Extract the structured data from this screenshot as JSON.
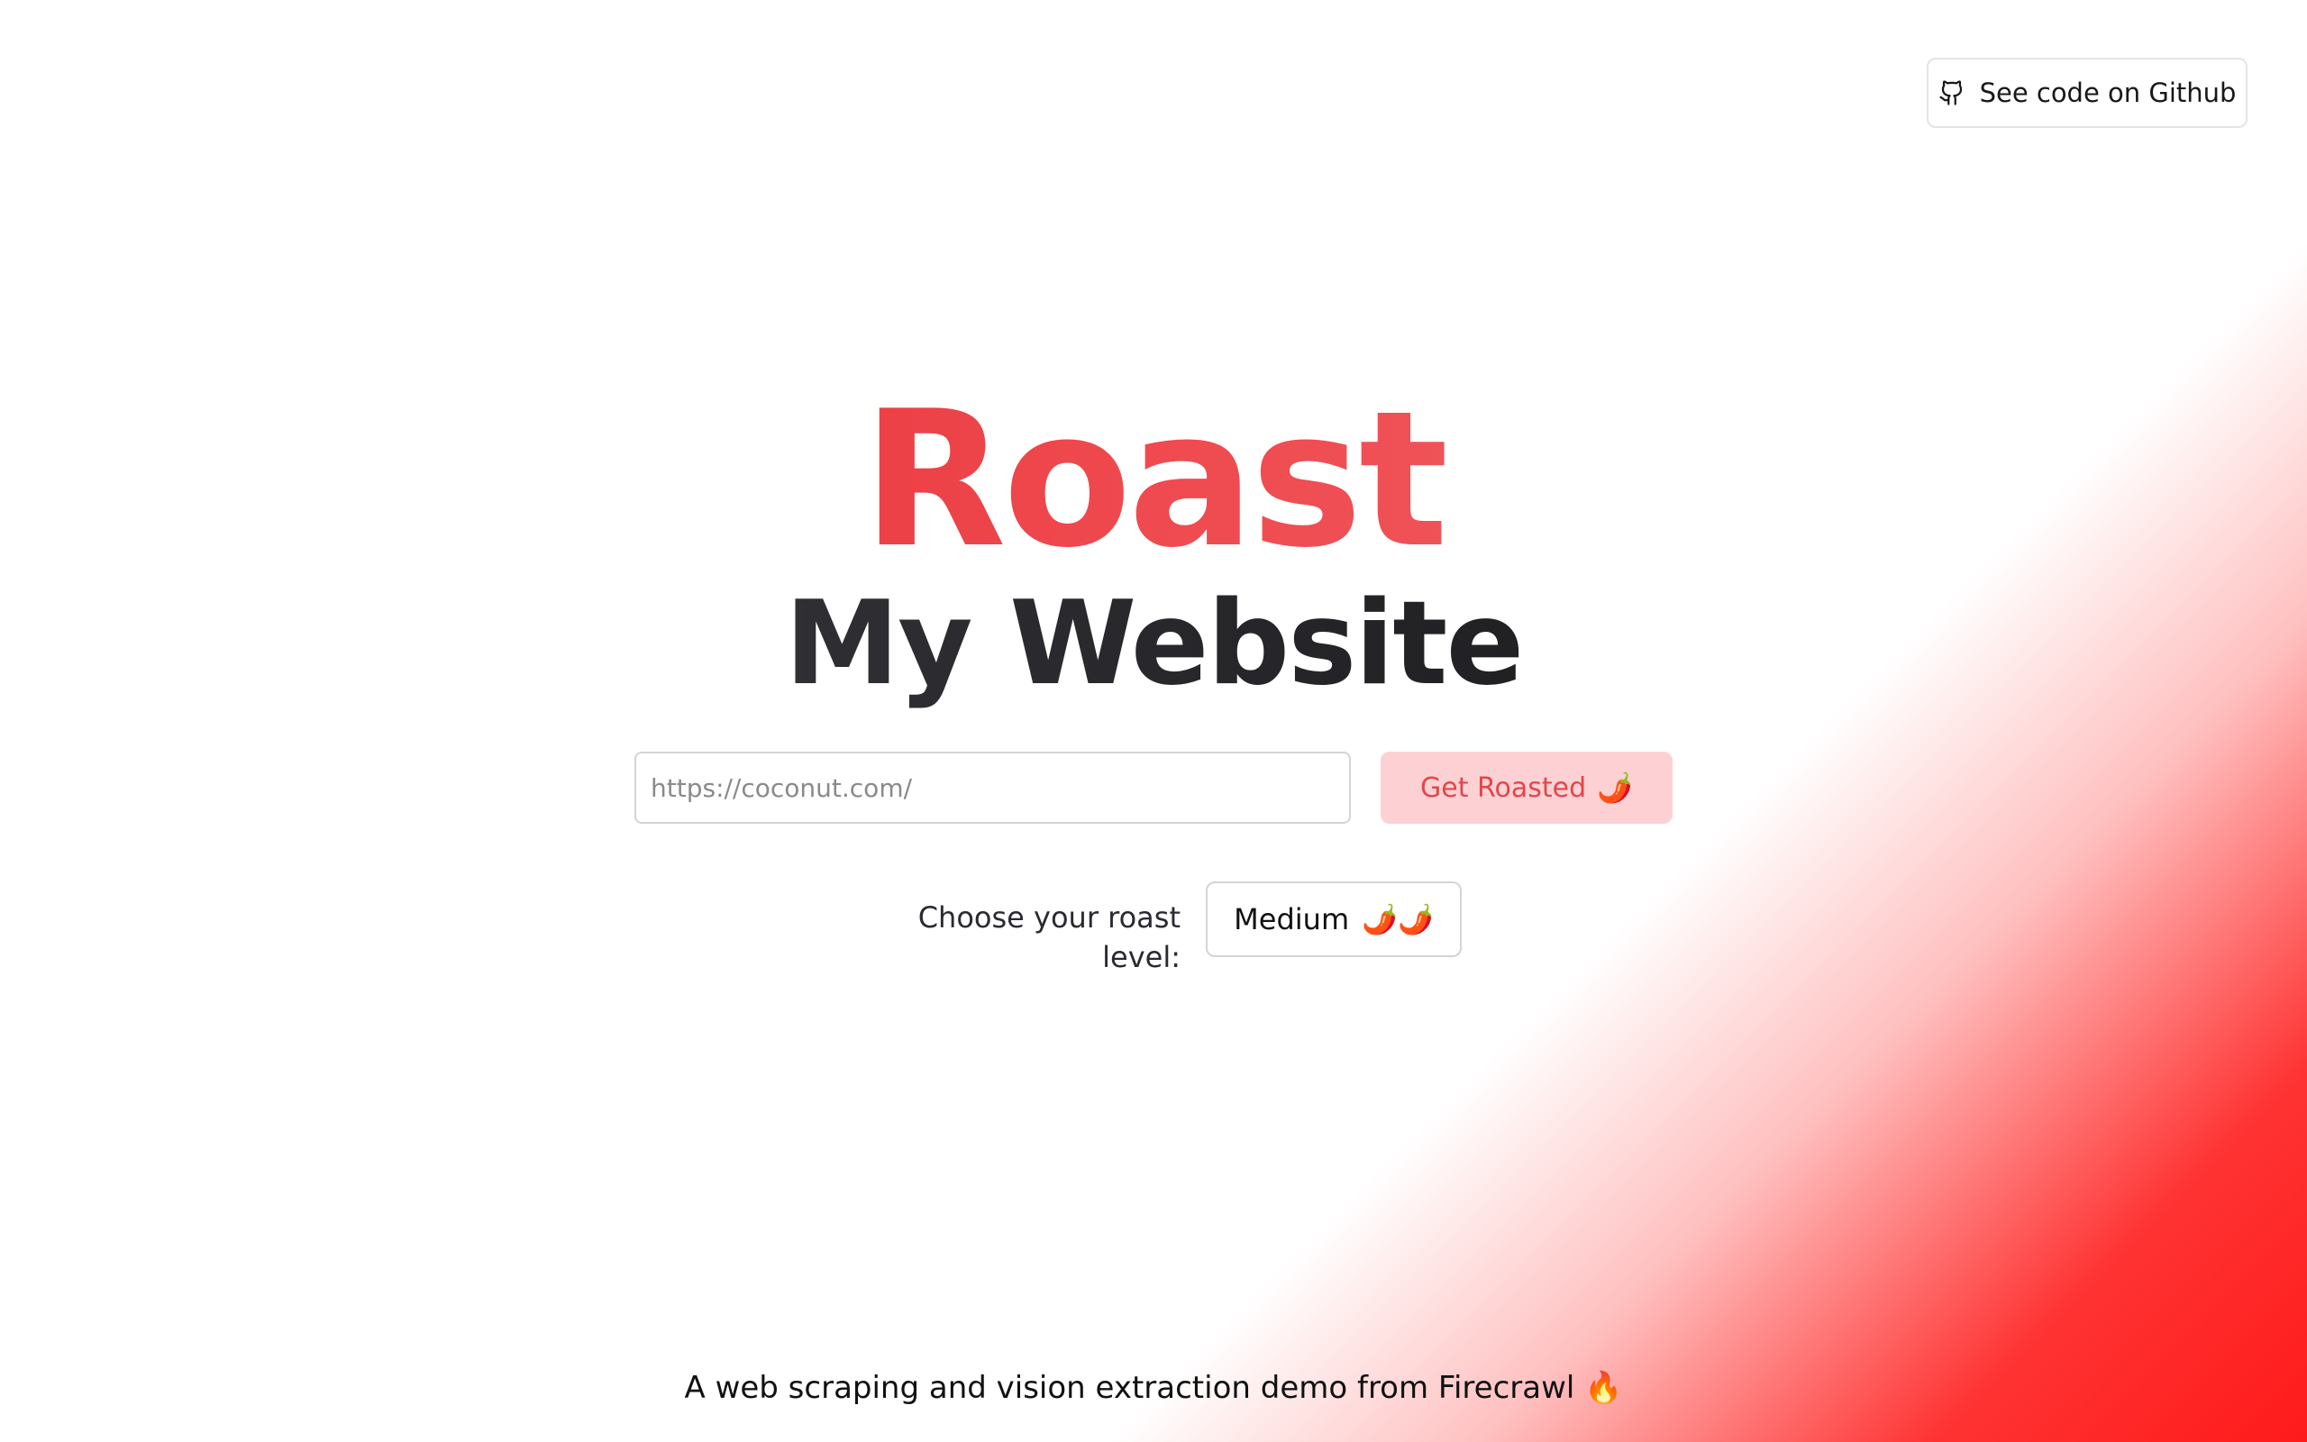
{
  "github_button": {
    "label": "See code on Github",
    "icon": "github-icon"
  },
  "hero": {
    "title_line1": "Roast",
    "title_line2": "My Website"
  },
  "url_input": {
    "placeholder": "https://coconut.com/",
    "value": ""
  },
  "submit_button": {
    "label": "Get Roasted",
    "emoji": "🌶️"
  },
  "roast_level": {
    "label": "Choose your roast level:",
    "selected": "Medium",
    "emoji": "🌶️🌶️"
  },
  "footer": {
    "text": "A web scraping and vision extraction demo from Firecrawl",
    "emoji": "🔥"
  },
  "colors": {
    "accent": "#e5383b",
    "button_bg": "#fdd1d3",
    "corner_gradient": "#ff1a1a"
  }
}
